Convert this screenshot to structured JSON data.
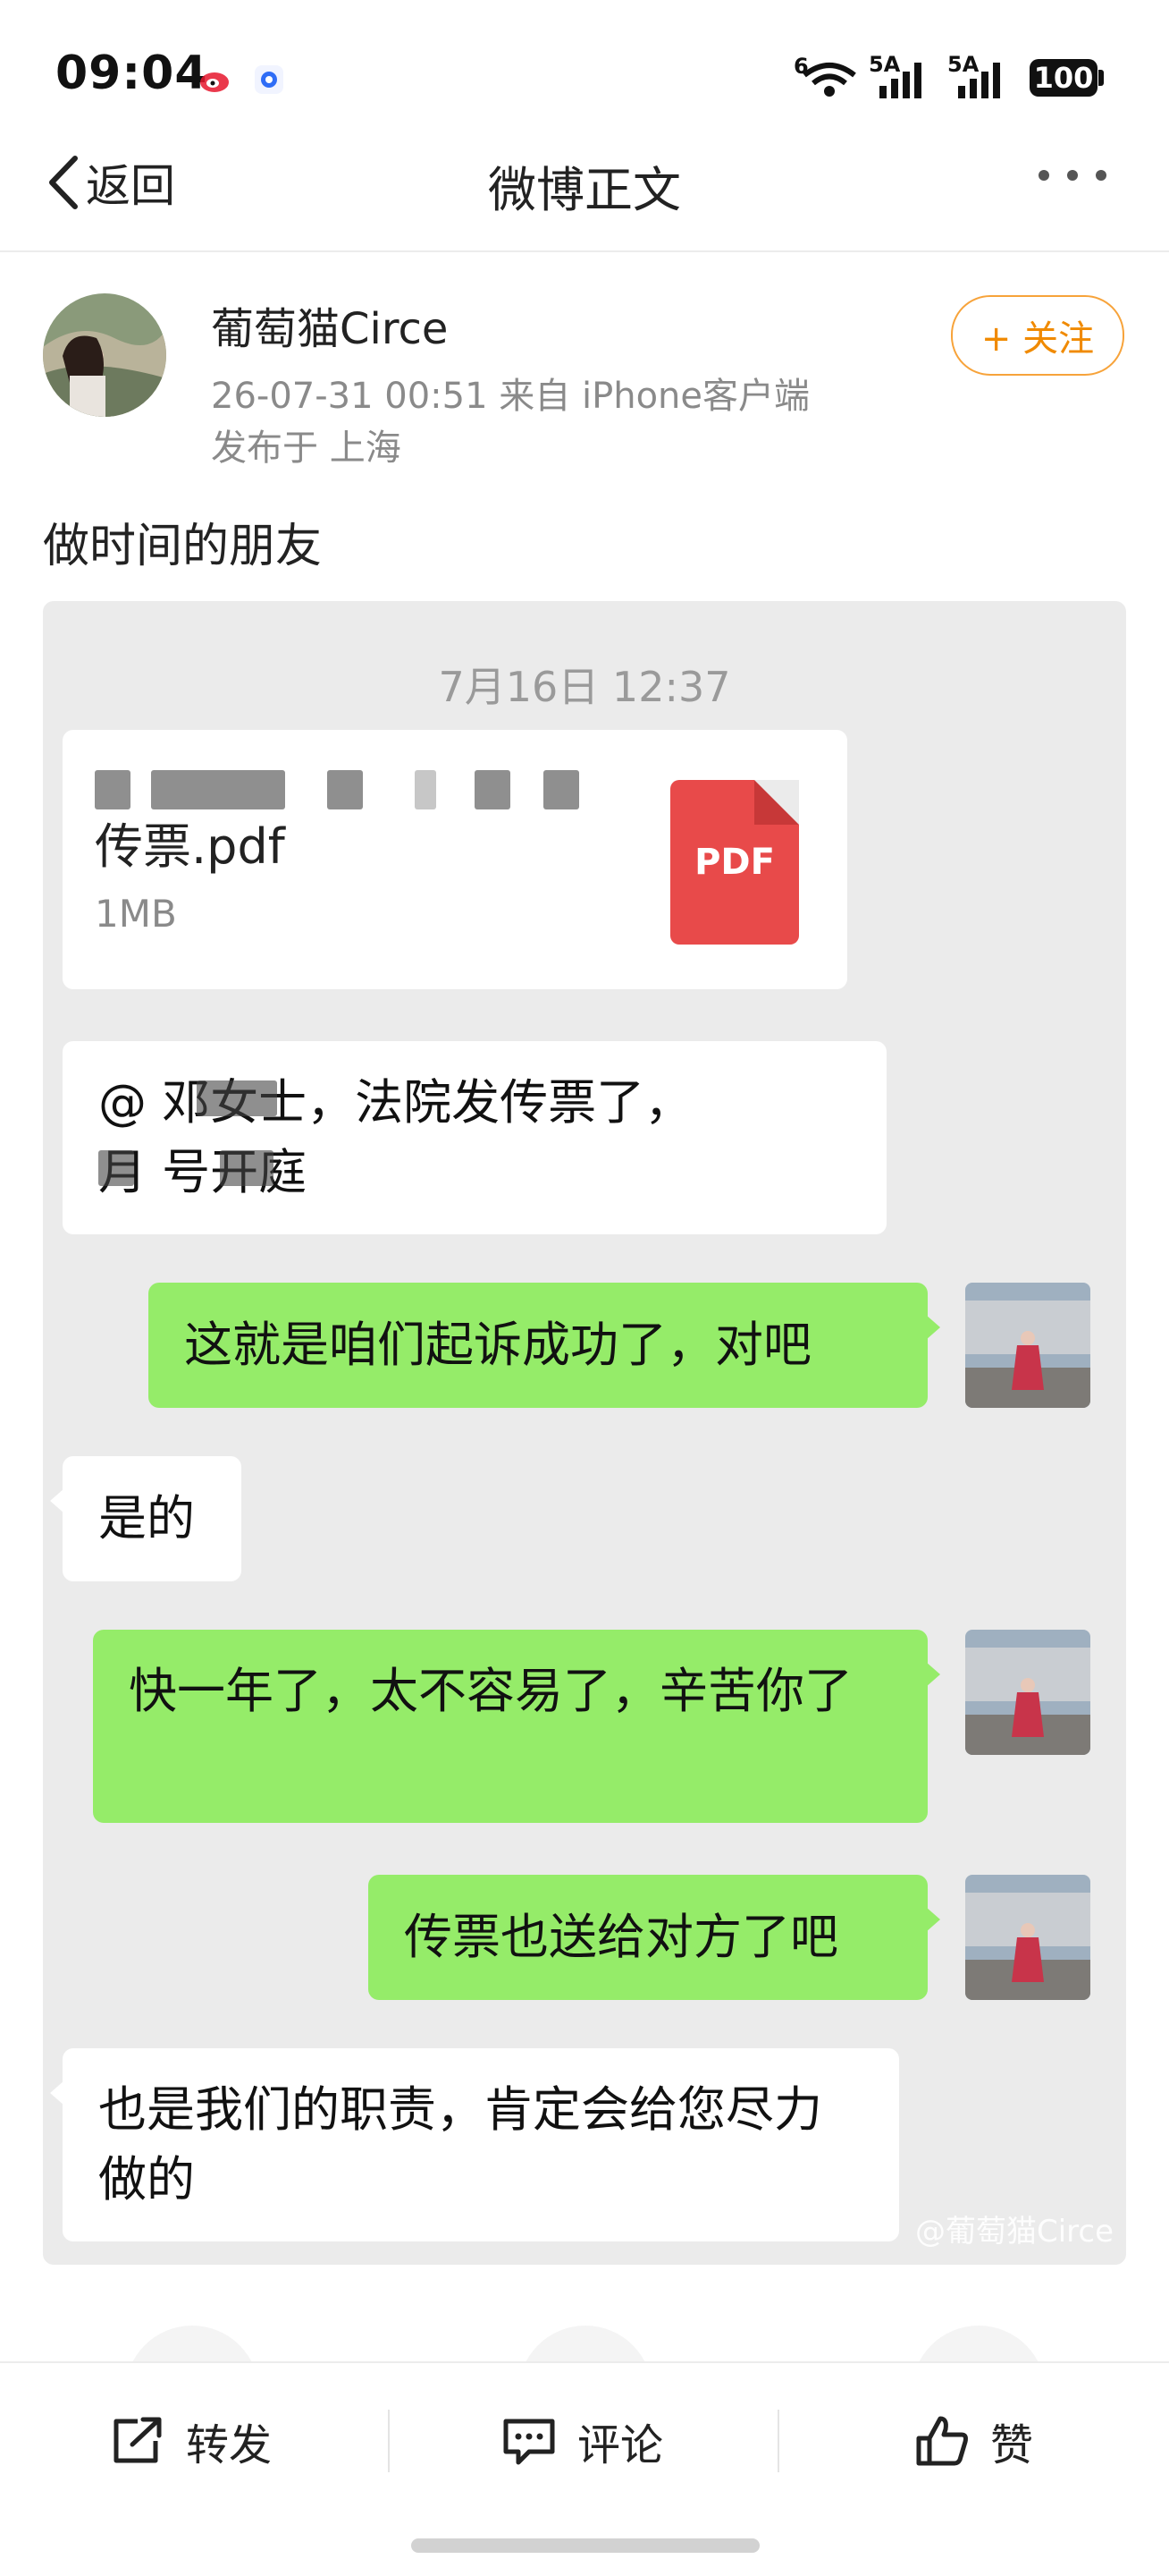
{
  "status_bar": {
    "time": "09:04",
    "app_icons": [
      "weibo-icon",
      "browser-icon"
    ],
    "wifi_label": "6",
    "signal1_label": "5A",
    "signal2_label": "5A",
    "battery": "100"
  },
  "nav": {
    "back_label": "返回",
    "title": "微博正文",
    "more_icon": "more-dots-icon"
  },
  "post": {
    "username": "葡萄猫Circe",
    "meta_line": "26-07-31 00:51  来自 iPhone客户端",
    "location_line": "发布于 上海",
    "follow_label": "+ 关注",
    "text": "做时间的朋友"
  },
  "chat": {
    "timestamp": "7月16日 12:37",
    "file": {
      "name_visible": "传票.pdf",
      "size": "1MB",
      "type_label": "PDF"
    },
    "messages": [
      {
        "side": "left",
        "line1_visible": "@   邓女士，法院发传票了，",
        "line2_visible": "月  号开庭"
      },
      {
        "side": "right",
        "text": "这就是咱们起诉成功了，对吧"
      },
      {
        "side": "left",
        "text": "是的"
      },
      {
        "side": "right",
        "text": "快一年了，太不容易了，辛苦你了"
      },
      {
        "side": "right",
        "text": "传票也送给对方了吧"
      },
      {
        "side": "left",
        "text": "也是我们的职责，肯定会给您尽力做的"
      }
    ],
    "watermark": "@葡萄猫Circe"
  },
  "actions": {
    "repost_label": "转发",
    "comment_label": "评论",
    "like_label": "赞"
  },
  "colors": {
    "accent_follow": "#f08a00",
    "bubble_right": "#95ec69",
    "pdf_red": "#e84a4a"
  }
}
